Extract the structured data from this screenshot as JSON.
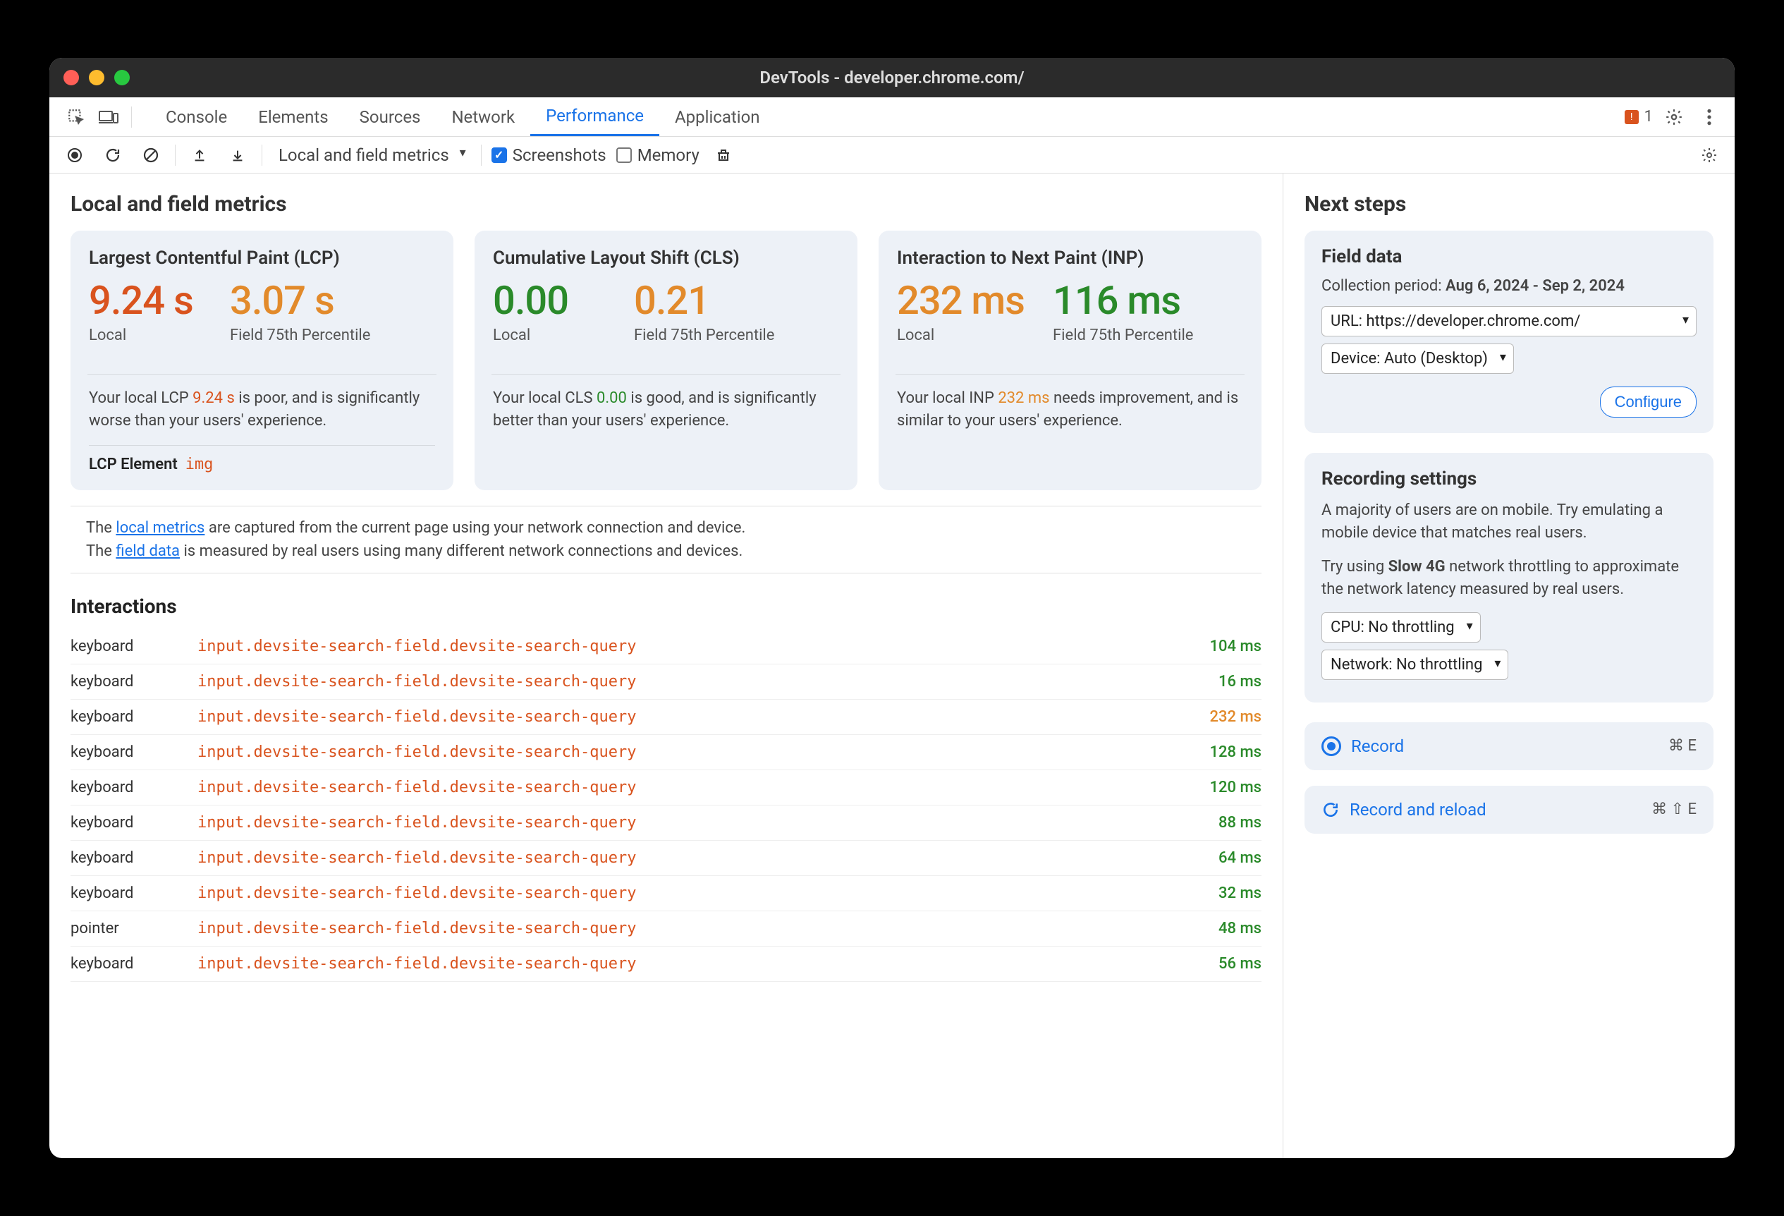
{
  "window": {
    "title": "DevTools - developer.chrome.com/"
  },
  "tabs": {
    "items": [
      "Console",
      "Elements",
      "Sources",
      "Network",
      "Performance",
      "Application"
    ],
    "active": "Performance",
    "issues_count": "1"
  },
  "toolbar": {
    "dropdown": "Local and field metrics",
    "screenshots_label": "Screenshots",
    "memory_label": "Memory"
  },
  "metrics_section": {
    "title": "Local and field metrics",
    "cards": [
      {
        "title": "Largest Contentful Paint (LCP)",
        "local_value": "9.24 s",
        "local_class": "red",
        "field_value": "3.07 s",
        "field_class": "orange",
        "local_label": "Local",
        "field_label": "Field 75th Percentile",
        "text_pre": "Your local LCP ",
        "text_val": "9.24 s",
        "text_val_class": "red",
        "text_post": " is poor, and is significantly worse than your users' experience.",
        "lcp_element_label": "LCP Element",
        "lcp_element_value": "img"
      },
      {
        "title": "Cumulative Layout Shift (CLS)",
        "local_value": "0.00",
        "local_class": "green",
        "field_value": "0.21",
        "field_class": "orange",
        "local_label": "Local",
        "field_label": "Field 75th Percentile",
        "text_pre": "Your local CLS ",
        "text_val": "0.00",
        "text_val_class": "green",
        "text_post": " is good, and is significantly better than your users' experience."
      },
      {
        "title": "Interaction to Next Paint (INP)",
        "local_value": "232 ms",
        "local_class": "orange",
        "field_value": "116 ms",
        "field_class": "green",
        "local_label": "Local",
        "field_label": "Field 75th Percentile",
        "text_pre": "Your local INP ",
        "text_val": "232 ms",
        "text_val_class": "orange",
        "text_post": " needs improvement, and is similar to your users' experience."
      }
    ],
    "info_line1_pre": "The ",
    "info_line1_link": "local metrics",
    "info_line1_post": " are captured from the current page using your network connection and device.",
    "info_line2_pre": "The ",
    "info_line2_link": "field data",
    "info_line2_post": " is measured by real users using many different network connections and devices."
  },
  "interactions": {
    "title": "Interactions",
    "rows": [
      {
        "kind": "keyboard",
        "selector": "input.devsite-search-field.devsite-search-query",
        "time": "104 ms",
        "time_class": "green"
      },
      {
        "kind": "keyboard",
        "selector": "input.devsite-search-field.devsite-search-query",
        "time": "16 ms",
        "time_class": "green"
      },
      {
        "kind": "keyboard",
        "selector": "input.devsite-search-field.devsite-search-query",
        "time": "232 ms",
        "time_class": "orange"
      },
      {
        "kind": "keyboard",
        "selector": "input.devsite-search-field.devsite-search-query",
        "time": "128 ms",
        "time_class": "green"
      },
      {
        "kind": "keyboard",
        "selector": "input.devsite-search-field.devsite-search-query",
        "time": "120 ms",
        "time_class": "green"
      },
      {
        "kind": "keyboard",
        "selector": "input.devsite-search-field.devsite-search-query",
        "time": "88 ms",
        "time_class": "green"
      },
      {
        "kind": "keyboard",
        "selector": "input.devsite-search-field.devsite-search-query",
        "time": "64 ms",
        "time_class": "green"
      },
      {
        "kind": "keyboard",
        "selector": "input.devsite-search-field.devsite-search-query",
        "time": "32 ms",
        "time_class": "green"
      },
      {
        "kind": "pointer",
        "selector": "input.devsite-search-field.devsite-search-query",
        "time": "48 ms",
        "time_class": "green"
      },
      {
        "kind": "keyboard",
        "selector": "input.devsite-search-field.devsite-search-query",
        "time": "56 ms",
        "time_class": "green"
      }
    ]
  },
  "next_steps": {
    "title": "Next steps",
    "field_data": {
      "heading": "Field data",
      "period_label": "Collection period: ",
      "period_value": "Aug 6, 2024 - Sep 2, 2024",
      "url_select": "URL: https://developer.chrome.com/",
      "device_select": "Device: Auto (Desktop)",
      "configure": "Configure"
    },
    "recording_settings": {
      "heading": "Recording settings",
      "p1": "A majority of users are on mobile. Try emulating a mobile device that matches real users.",
      "p2_pre": "Try using ",
      "p2_bold": "Slow 4G",
      "p2_post": " network throttling to approximate the network latency measured by real users.",
      "cpu_select": "CPU: No throttling",
      "net_select": "Network: No throttling"
    },
    "record": {
      "label": "Record",
      "shortcut": "⌘ E"
    },
    "record_reload": {
      "label": "Record and reload",
      "shortcut": "⌘ ⇧ E"
    }
  }
}
